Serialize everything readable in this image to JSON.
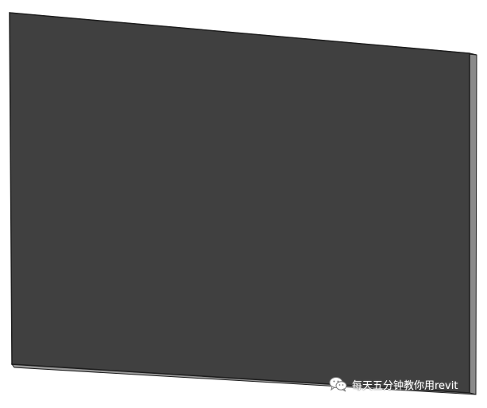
{
  "scene": {
    "object": "wall-panel",
    "colors": {
      "background": "#ffffff",
      "face": "#404040",
      "face_edge": "#2a2a2a",
      "side": "#8a8a8a",
      "bottom": "#9a9a9a",
      "outline": "#1e1e1e"
    }
  },
  "watermark": {
    "text": "每天五分钟教你用revit",
    "icon": "wechat-icon",
    "text_color": "#ffffff"
  }
}
